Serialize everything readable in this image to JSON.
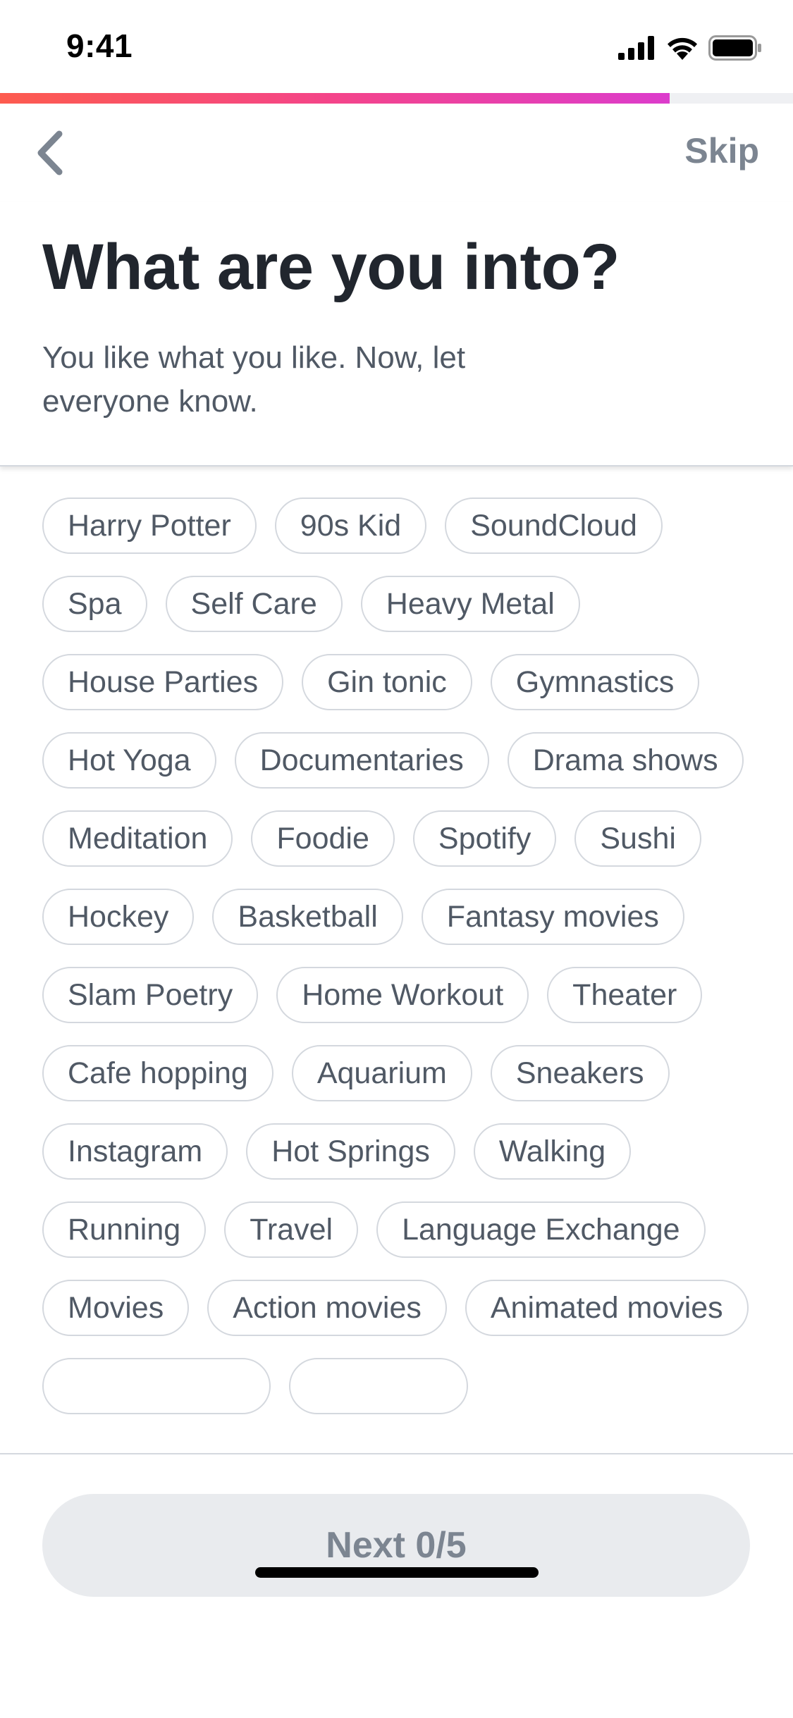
{
  "status_bar": {
    "time": "9:41"
  },
  "progress": {
    "fraction": 0.844,
    "colors": [
      "#fd5b4e",
      "#f4448a",
      "#dc3ccc"
    ]
  },
  "nav": {
    "back_icon": "chevron-left-icon",
    "skip_label": "Skip"
  },
  "header": {
    "title": "What are you into?",
    "subtitle": "You like what you like. Now, let everyone know."
  },
  "interests": [
    "Harry Potter",
    "90s Kid",
    "SoundCloud",
    "Spa",
    "Self Care",
    "Heavy Metal",
    "House Parties",
    "Gin tonic",
    "Gymnastics",
    "Hot Yoga",
    "Documentaries",
    "Drama shows",
    "Meditation",
    "Foodie",
    "Spotify",
    "Sushi",
    "Hockey",
    "Basketball",
    "Fantasy movies",
    "Slam Poetry",
    "Home Workout",
    "Theater",
    "Cafe hopping",
    "Aquarium",
    "Sneakers",
    "Instagram",
    "Hot Springs",
    "Walking",
    "Running",
    "Travel",
    "Language Exchange",
    "Movies",
    "Action movies",
    "Animated movies",
    "",
    ""
  ],
  "footer": {
    "next_label": "Next 0/5"
  },
  "colors": {
    "title_text": "#21262e",
    "body_text": "#505965",
    "muted_text": "#7c8591",
    "chip_border": "#d4d8de",
    "button_bg": "#e9ebee"
  }
}
